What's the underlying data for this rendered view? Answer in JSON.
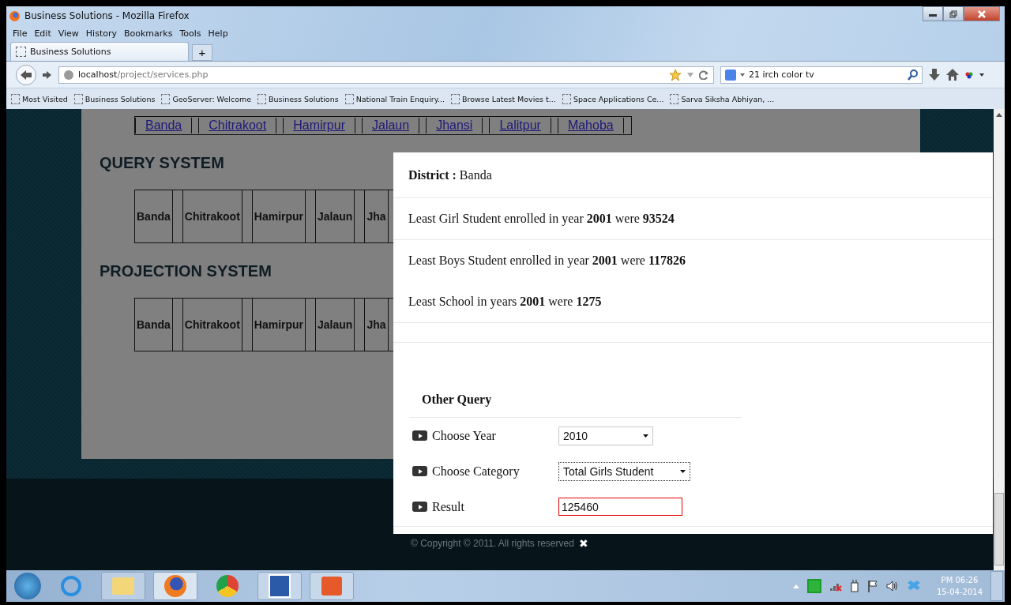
{
  "window": {
    "title": "Business Solutions - Mozilla Firefox"
  },
  "menu": [
    "File",
    "Edit",
    "View",
    "History",
    "Bookmarks",
    "Tools",
    "Help"
  ],
  "tabs": [
    {
      "label": "Business Solutions",
      "selected": true
    }
  ],
  "new_tab": "+",
  "address": {
    "host": "localhost",
    "path": "/project/services.php"
  },
  "search": {
    "value": "21 irch color tv"
  },
  "bookmarks": [
    "Most Visited",
    "Business Solutions",
    "GeoServer: Welcome",
    "Business Solutions",
    "National Train Enquiry...",
    "Browse Latest Movies t...",
    "Space Applications Ce...",
    "Sarva Siksha Abhiyan, ..."
  ],
  "district_links": [
    "Banda",
    "Chitrakoot",
    "Hamirpur",
    "Jalaun",
    "Jhansi",
    "Lalitpur",
    "Mahoba"
  ],
  "sections": [
    {
      "heading": "QUERY SYSTEM",
      "cells": [
        "Banda",
        "Chitrakoot",
        "Hamirpur",
        "Jalaun",
        "Jha"
      ]
    },
    {
      "heading": "PROJECTION SYSTEM",
      "cells": [
        "Banda",
        "Chitrakoot",
        "Hamirpur",
        "Jalaun",
        "Jha"
      ]
    }
  ],
  "modal": {
    "district_label": "District :",
    "district": "Banda",
    "lines": [
      "Least Girl Student enrolled in year **2001** were **93524**",
      "Least Boys Student enrolled in year **2001** were **117826**",
      "Least School in years **2001** were **1275**"
    ],
    "other_query": "Other Query",
    "fields": [
      {
        "kind": "select",
        "label": "Choose Year",
        "value": "2010"
      },
      {
        "kind": "select",
        "label": "Choose Category",
        "value": "Total Girls Student"
      },
      {
        "kind": "input",
        "label": "Result",
        "value": "125460"
      }
    ]
  },
  "footer": {
    "copyright": "© Copyright © 2011. All rights reserved",
    "close": "✖"
  },
  "taskbar": {
    "time": "PM 06:26",
    "date": "15-04-2014"
  }
}
